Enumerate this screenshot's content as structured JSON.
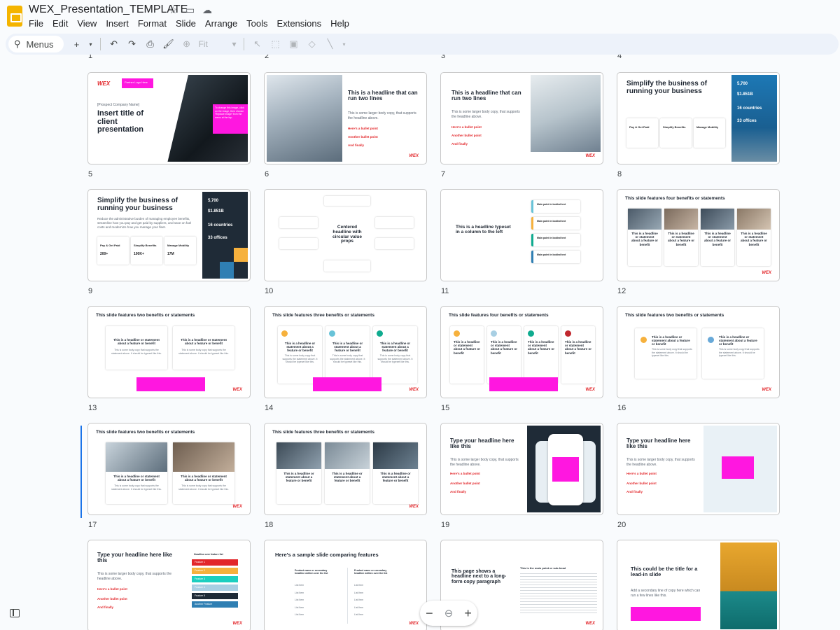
{
  "app": {
    "title": "WEX_Presentation_TEMPLATE",
    "menus": [
      "File",
      "Edit",
      "View",
      "Insert",
      "Format",
      "Slide",
      "Arrange",
      "Tools",
      "Extensions",
      "Help"
    ]
  },
  "toolbar": {
    "menus_label": "Menus",
    "zoom_label": "Fit"
  },
  "slide_numbers": [
    "1",
    "2",
    "3",
    "4",
    "5",
    "6",
    "7",
    "8",
    "9",
    "10",
    "11",
    "12",
    "13",
    "14",
    "15",
    "16",
    "17",
    "18",
    "19",
    "20"
  ],
  "slides": {
    "s5": {
      "tag": "Partner Logo Here",
      "company": "[Prospect Company Name]",
      "title": "Insert title of client presentation",
      "callout": "To change this image, click on the image, then choose 'Replace image' from the menu at the top."
    },
    "s6": {
      "title": "This is a headline that can run two lines",
      "body": "This is some larger body copy, that supports the headline above.",
      "b1": "Here's a bullet point",
      "b2": "Another bullet point",
      "b3": "And finally"
    },
    "s7": {
      "title": "This is a headline that can run two lines",
      "body": "This is some larger body copy, that supports the headline above.",
      "b1": "Here's a bullet point",
      "b2": "Another bullet point",
      "b3": "And finally"
    },
    "s8": {
      "title": "Simplify the business of running your business",
      "stat1": "5,700",
      "stat2": "$1.851B",
      "stat3": "16 countries",
      "stat4": "33 offices",
      "c1": "Pay & Get Paid",
      "c2": "Simplify Benefits",
      "c3": "Manage Mobility",
      "n1": "200+",
      "n2": "20+",
      "n3": "100K+",
      "n4": "17M",
      "n5": "+95%"
    },
    "s9": {
      "title": "Simplify the business of running your business",
      "body": "Reduce the administrative burden of managing employee benefits, streamline how you pay and get paid by suppliers, and save on fuel costs and modernize how you manage your fleet.",
      "stat1": "5,700",
      "stat2": "$1.851B",
      "stat3": "16 countries",
      "stat4": "33 offices",
      "c1": "Pay & Get Paid",
      "c2": "Simplify Benefits",
      "c3": "Manage Mobility",
      "n1": "200+",
      "n2": "20+",
      "n3": "100K+",
      "n4": "17M",
      "n5": "+95%"
    },
    "s10": {
      "title": "Centered headline with circular value props"
    },
    "s11": {
      "title": "This is a headline typeset in a column to the left",
      "item": "Main point in bolded text"
    },
    "s12": {
      "title": "This slide features four benefits or statements"
    },
    "s13": {
      "title": "This slide features two benefits or statements"
    },
    "s14": {
      "title": "This slide features three benefits or statements"
    },
    "s15": {
      "title": "This slide features four benefits or statements"
    },
    "s16": {
      "title": "This slide features two benefits or statements"
    },
    "s17": {
      "title": "This slide features two benefits or statements"
    },
    "s18": {
      "title": "This slide features three benefits or statements"
    },
    "s19": {
      "title": "Type your headline here like this",
      "body": "This is some larger body copy, that supports the headline above.",
      "b1": "Here's a bullet point",
      "b2": "Another bullet point",
      "b3": "And finally"
    },
    "s20": {
      "title": "Type your headline here like this",
      "body": "This is some larger body copy, that supports the headline above.",
      "b1": "Here's a bullet point",
      "b2": "Another bullet point",
      "b3": "And finally"
    },
    "s21": {
      "title": "Type your headline here like this",
      "body": "This is some larger body copy, that supports the headline above.",
      "b1": "Here's a bullet point",
      "b2": "Another bullet point",
      "b3": "And finally",
      "list_title": "Headline over feature list",
      "f1": "Feature 1",
      "f2": "Feature 2",
      "f3": "Feature 3",
      "f4": "Feature 4",
      "f5": "Feature 5",
      "f6": "Another Feature"
    },
    "s22": {
      "title": "Here's a sample slide comparing features",
      "col": "Product name or secondary headline written over the list",
      "item": "List Item"
    },
    "s23": {
      "title": "This page shows a headline next to a long-form copy paragraph",
      "sub": "This is the main point or sub-head"
    },
    "s24": {
      "title": "This could be the title for a lead-in slide",
      "body": "Add a secondary line of copy here which can run a few lines like this."
    }
  },
  "common": {
    "card_head": "This is a headline or statement about a feature or benefit",
    "card_body": "This is some body copy that supports the statement above. It should be typeset like this.",
    "brand": "WEX",
    "footer": "Proprietary & Confidential"
  },
  "colors": {
    "brand_red": "#e2262a",
    "magenta": "#ff17e0",
    "navy": "#1f2b37",
    "selection": "#1a73e8"
  }
}
